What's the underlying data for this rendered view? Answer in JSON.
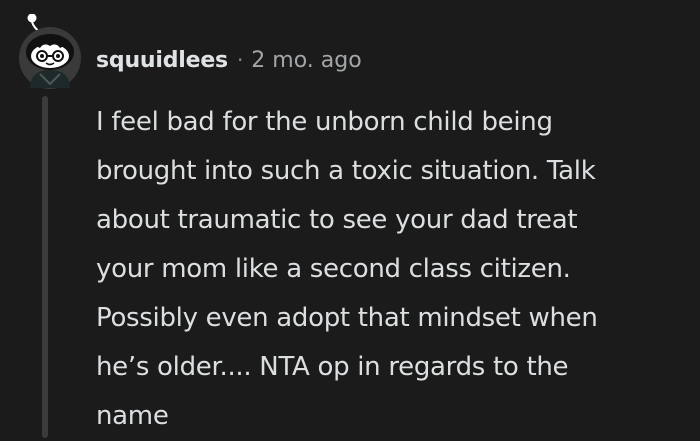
{
  "comment": {
    "author": "squuidlees",
    "separator": "·",
    "timestamp": "2 mo. ago",
    "body_lines": [
      "I feel bad for the unborn child being",
      "brought into such a toxic situation. Talk",
      "about traumatic to see your dad treat",
      "your mom like a second class citizen.",
      "Possibly even adopt that mindset when",
      "he’s older.... NTA op in regards to the",
      "name"
    ]
  },
  "colors": {
    "background": "#1b1b1b",
    "text": "#dcdfe1",
    "muted": "#a3a6a8",
    "thread_line": "#3b3b3b"
  },
  "icons": {
    "avatar": "snoo-avatar-icon"
  }
}
